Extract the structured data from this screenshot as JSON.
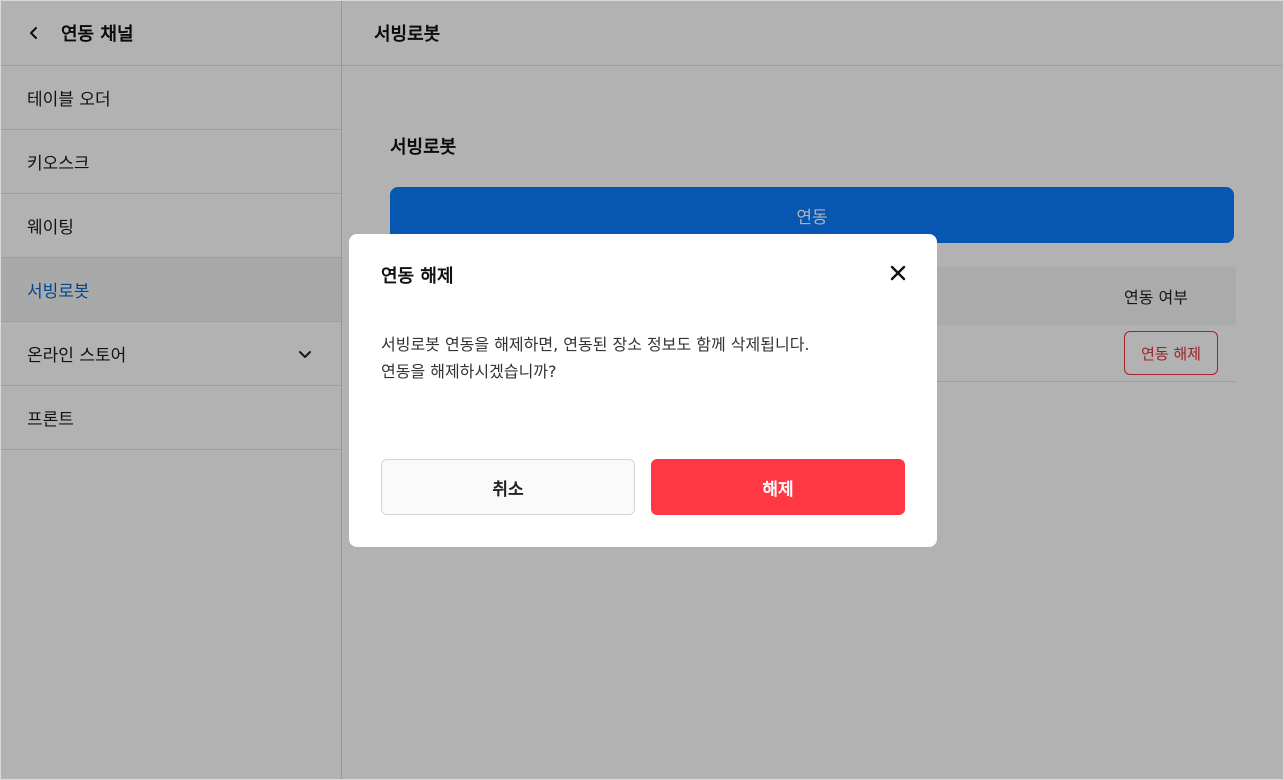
{
  "sidebar": {
    "title": "연동 채널",
    "back_icon": "chevron-left-icon",
    "items": [
      {
        "label": "테이블 오더",
        "active": false
      },
      {
        "label": "키오스크",
        "active": false
      },
      {
        "label": "웨이팅",
        "active": false
      },
      {
        "label": "서빙로봇",
        "active": true
      },
      {
        "label": "온라인 스토어",
        "active": false,
        "expandable": true,
        "icon": "chevron-down-icon"
      },
      {
        "label": "프론트",
        "active": false
      }
    ]
  },
  "main": {
    "header_title": "서빙로봇",
    "section_title": "서빙로봇",
    "connect_button_label": "연동",
    "table": {
      "header_status": "연동 여부",
      "row_action_label": "연동 해제"
    }
  },
  "modal": {
    "title": "연동 해제",
    "close_icon": "close-icon",
    "message_line1": "서빙로봇 연동을 해제하면, 연동된 장소 정보도 함께 삭제됩니다.",
    "message_line2": "연동을 해제하시겠습니까?",
    "cancel_label": "취소",
    "confirm_label": "해제"
  },
  "colors": {
    "primary": "#0a7bff",
    "danger": "#ff3844",
    "active_text": "#0066cc"
  }
}
